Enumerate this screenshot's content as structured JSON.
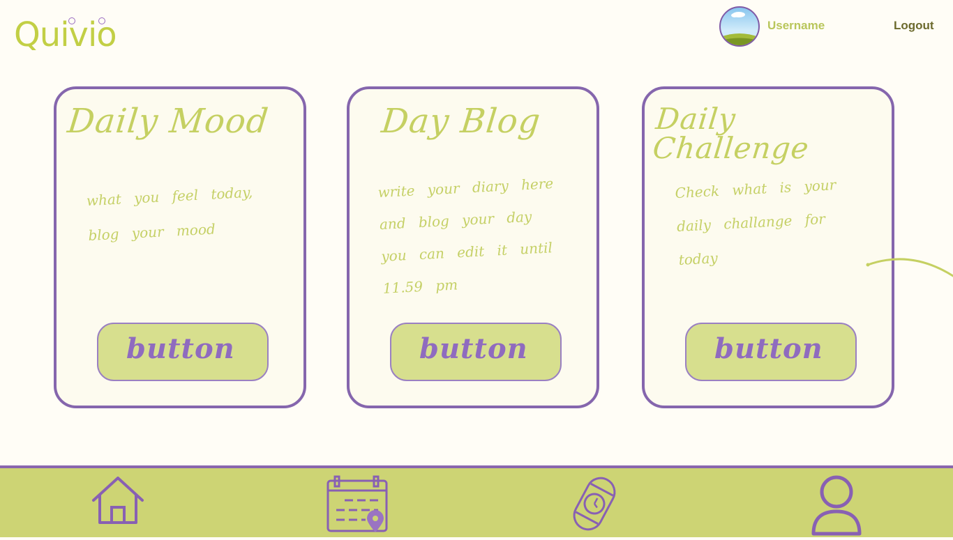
{
  "header": {
    "logo_text": "Quivio",
    "username": "Username",
    "logout_label": "Logout"
  },
  "cards": [
    {
      "title": "Daily Mood",
      "description": "what you feel today, blog your mood",
      "button_label": "button"
    },
    {
      "title": "Day Blog",
      "description": "write your diary here and blog your day you can edit it until 11.59 pm",
      "button_label": "button"
    },
    {
      "title": "Daily Challenge",
      "description": "Check what is your daily challange for today",
      "button_label": "button"
    }
  ],
  "navbar": {
    "items": [
      {
        "icon": "home-icon"
      },
      {
        "icon": "calendar-location-icon"
      },
      {
        "icon": "watch-icon"
      },
      {
        "icon": "user-icon"
      }
    ]
  },
  "colors": {
    "accent_green": "#c2cf45",
    "accent_purple": "#8566ad",
    "navbar_bg": "#cdd474"
  }
}
